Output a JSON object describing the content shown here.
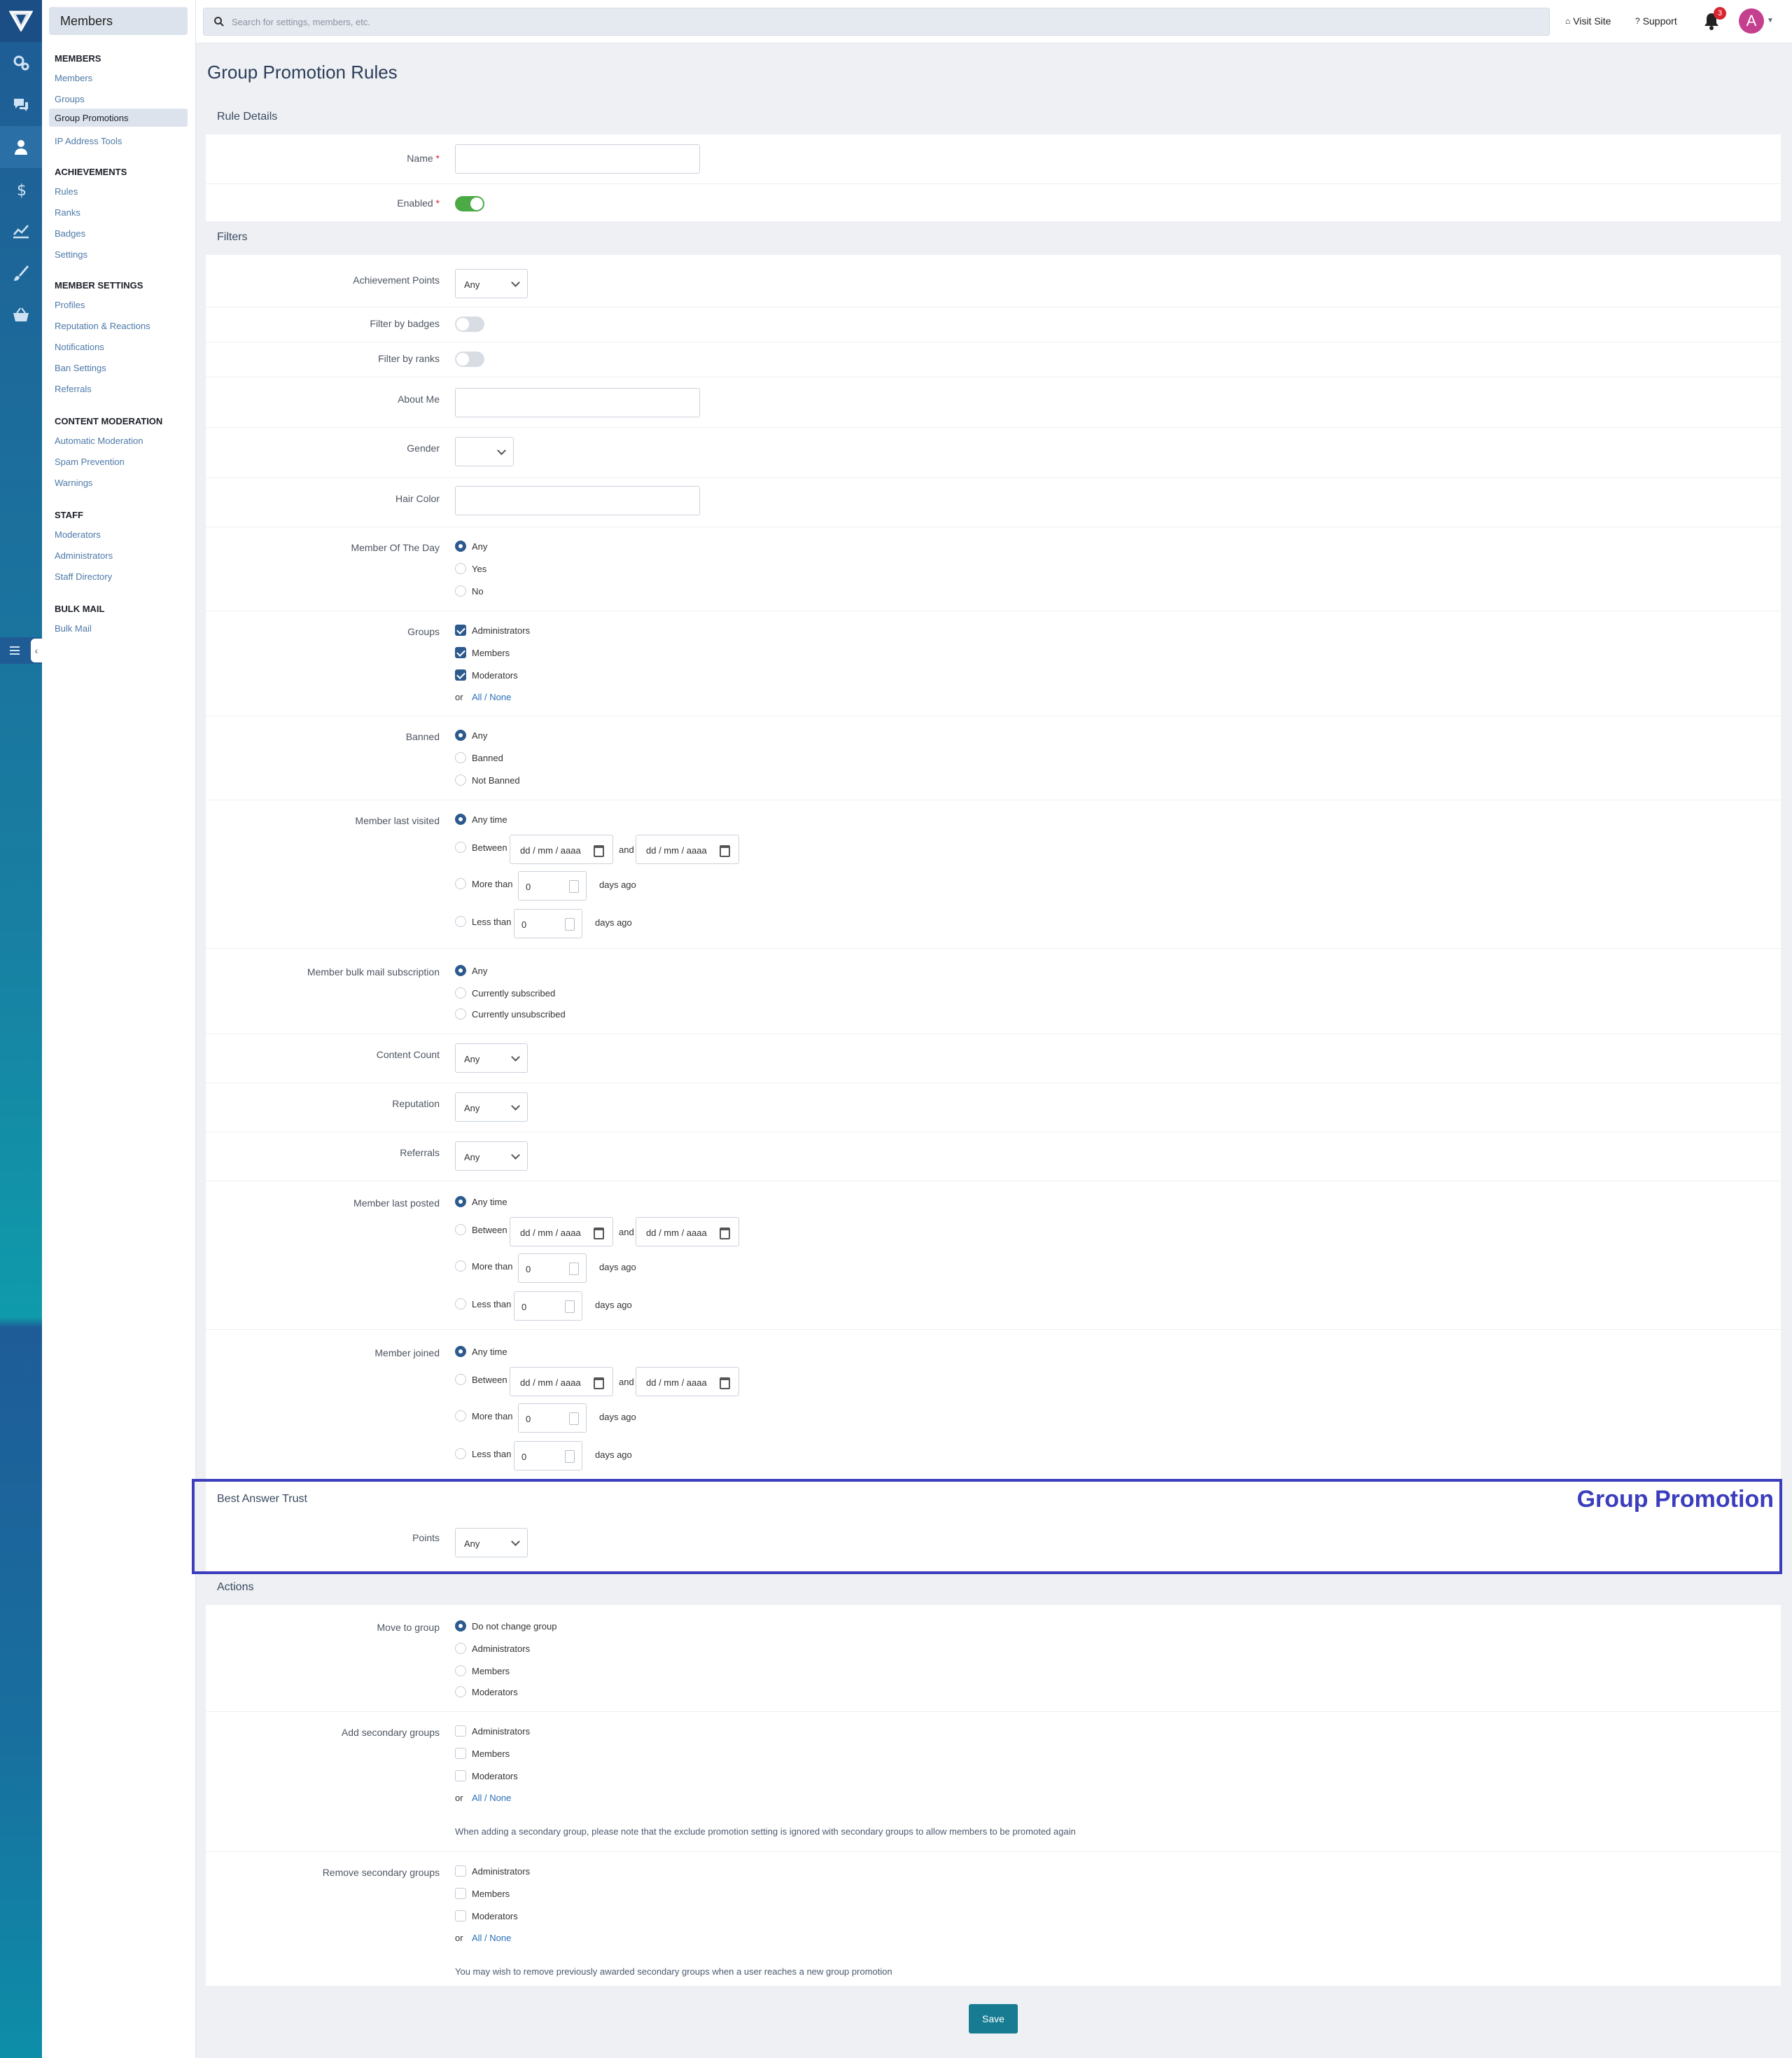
{
  "submenu": {
    "title": "Members",
    "sections": [
      {
        "heading": "MEMBERS",
        "items": [
          "Members",
          "Groups",
          "Group Promotions",
          "IP Address Tools"
        ]
      },
      {
        "heading": "ACHIEVEMENTS",
        "items": [
          "Rules",
          "Ranks",
          "Badges",
          "Settings"
        ]
      },
      {
        "heading": "MEMBER SETTINGS",
        "items": [
          "Profiles",
          "Reputation & Reactions",
          "Notifications",
          "Ban Settings",
          "Referrals"
        ]
      },
      {
        "heading": "CONTENT MODERATION",
        "items": [
          "Automatic Moderation",
          "Spam Prevention",
          "Warnings"
        ]
      },
      {
        "heading": "STAFF",
        "items": [
          "Moderators",
          "Administrators",
          "Staff Directory"
        ]
      },
      {
        "heading": "BULK MAIL",
        "items": [
          "Bulk Mail"
        ]
      }
    ]
  },
  "topbar": {
    "search_placeholder": "Search for settings, members, etc.",
    "visit_site": "Visit Site",
    "support": "Support",
    "notification_count": "3",
    "avatar_letter": "A"
  },
  "page": {
    "title": "Group Promotion Rules",
    "sections": {
      "rule_details": "Rule Details",
      "filters": "Filters",
      "best_answer": "Best Answer Trust",
      "actions": "Actions"
    },
    "overlay_label": "Group Promotion",
    "save": "Save"
  },
  "fields": {
    "name": "Name",
    "required_mark": "*",
    "enabled": "Enabled",
    "achievement_points": "Achievement Points",
    "filter_badges": "Filter by badges",
    "filter_ranks": "Filter by ranks",
    "about_me": "About Me",
    "gender": "Gender",
    "hair_color": "Hair Color",
    "member_of_day": "Member Of The Day",
    "groups": "Groups",
    "banned": "Banned",
    "last_visited": "Member last visited",
    "bulk_mail": "Member bulk mail subscription",
    "content_count": "Content Count",
    "reputation": "Reputation",
    "referrals": "Referrals",
    "last_posted": "Member last posted",
    "joined": "Member joined",
    "points": "Points",
    "move_to_group": "Move to group",
    "add_secondary": "Add secondary groups",
    "remove_secondary": "Remove secondary groups"
  },
  "values": {
    "any": "Any",
    "yes": "Yes",
    "no": "No",
    "banned": "Banned",
    "not_banned": "Not Banned",
    "any_time": "Any time",
    "between": "Between",
    "and": "and",
    "more_than": "More than",
    "less_than": "Less than",
    "days_ago": "days ago",
    "date_placeholder": "dd / mm / aaaa",
    "zero": "0",
    "currently_subscribed": "Currently subscribed",
    "currently_unsubscribed": "Currently unsubscribed",
    "do_not_change": "Do not change group",
    "or": "or",
    "all_none": "All / None",
    "add_hint": "When adding a secondary group, please note that the exclude promotion setting is ignored with secondary groups to allow members to be promoted again",
    "remove_hint": "You may wish to remove previously awarded secondary groups when a user reaches a new group promotion"
  },
  "groups": [
    "Administrators",
    "Members",
    "Moderators"
  ],
  "colors": {
    "accent": "#2c5a8e",
    "toggle_on": "#4caa44",
    "save": "#177c92",
    "overlay": "#3b3dbd"
  }
}
